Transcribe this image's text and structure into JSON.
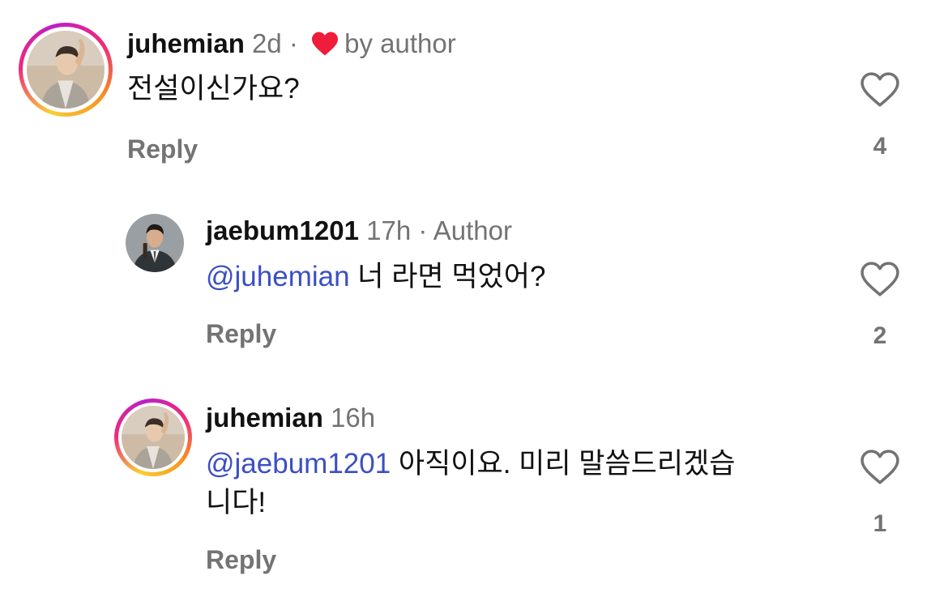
{
  "comments": [
    {
      "username": "juhemian",
      "time": "2d",
      "separator": "·",
      "liked_by_author_label": "by author",
      "text": "전설이신가요?",
      "reply_label": "Reply",
      "like_count": "4",
      "has_story_ring": true
    },
    {
      "username": "jaebum1201",
      "time": "17h",
      "separator": "·",
      "author_label": "Author",
      "mention": "@juhemian",
      "text": " 너 라면 먹었어?",
      "reply_label": "Reply",
      "like_count": "2",
      "has_story_ring": false
    },
    {
      "username": "juhemian",
      "time": "16h",
      "mention": "@jaebum1201",
      "text_line1": " 아직이요. 미리 말씀드리겠습",
      "text_line2": "니다!",
      "reply_label": "Reply",
      "like_count": "1",
      "has_story_ring": true
    }
  ],
  "icons": {
    "like": "heart-outline-icon",
    "author_like": "heart-filled-icon"
  },
  "colors": {
    "mention": "#3b4fc4",
    "muted": "#737373",
    "heart_red": "#ee1d3b"
  }
}
